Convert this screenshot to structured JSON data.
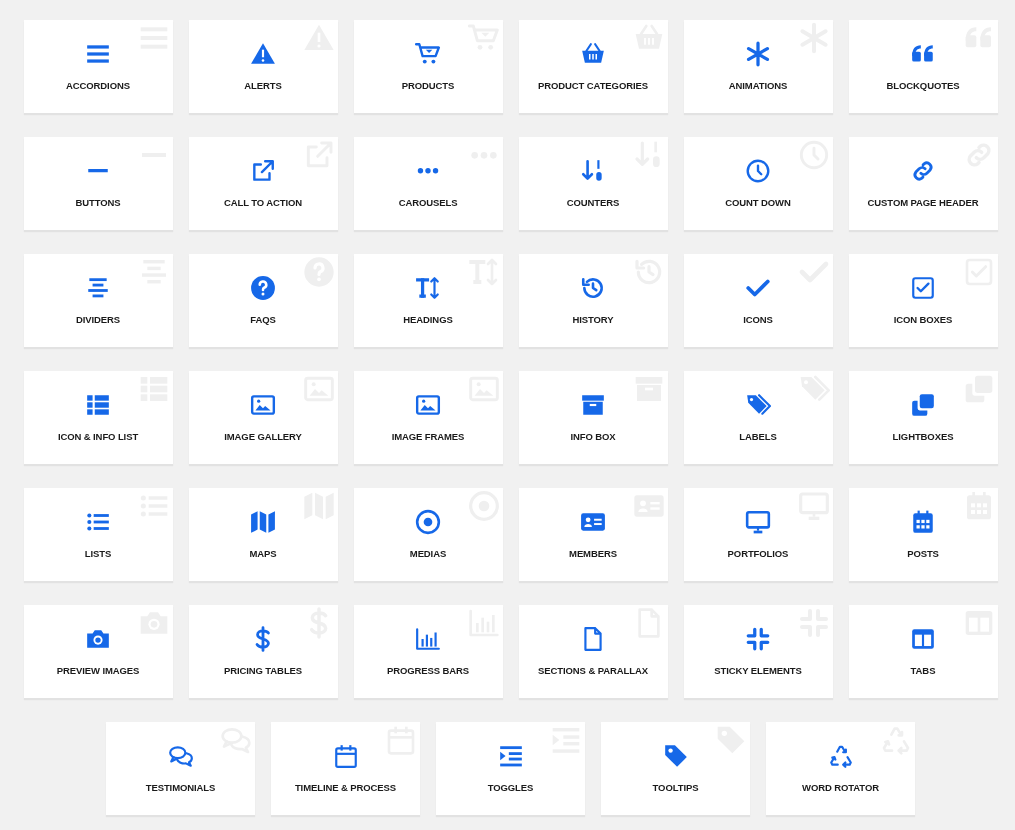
{
  "rows": [
    {
      "cards": [
        {
          "label": "ACCORDIONS"
        },
        {
          "label": "ALERTS"
        },
        {
          "label": "PRODUCTS"
        },
        {
          "label": "PRODUCT CATEGORIES"
        },
        {
          "label": "ANIMATIONS"
        },
        {
          "label": "BLOCKQUOTES"
        }
      ]
    },
    {
      "cards": [
        {
          "label": "BUTTONS"
        },
        {
          "label": "CALL TO ACTION"
        },
        {
          "label": "CAROUSELS"
        },
        {
          "label": "COUNTERS"
        },
        {
          "label": "COUNT DOWN"
        },
        {
          "label": "CUSTOM PAGE HEADER"
        }
      ]
    },
    {
      "cards": [
        {
          "label": "DIVIDERS"
        },
        {
          "label": "FAQS"
        },
        {
          "label": "HEADINGS"
        },
        {
          "label": "HISTORY"
        },
        {
          "label": "ICONS"
        },
        {
          "label": "ICON BOXES"
        }
      ]
    },
    {
      "cards": [
        {
          "label": "ICON & INFO LIST"
        },
        {
          "label": "IMAGE GALLERY"
        },
        {
          "label": "IMAGE FRAMES"
        },
        {
          "label": "INFO BOX"
        },
        {
          "label": "LABELS"
        },
        {
          "label": "LIGHTBOXES"
        }
      ]
    },
    {
      "cards": [
        {
          "label": "LISTS"
        },
        {
          "label": "MAPS"
        },
        {
          "label": "MEDIAS"
        },
        {
          "label": "MEMBERS"
        },
        {
          "label": "PORTFOLIOS"
        },
        {
          "label": "POSTS"
        }
      ]
    },
    {
      "cards": [
        {
          "label": "PREVIEW IMAGES"
        },
        {
          "label": "PRICING TABLES"
        },
        {
          "label": "PROGRESS BARS"
        },
        {
          "label": "SECTIONS & PARALLAX"
        },
        {
          "label": "STICKY ELEMENTS"
        },
        {
          "label": "TABS"
        }
      ]
    },
    {
      "cards": [
        {
          "label": "TESTIMONIALS"
        },
        {
          "label": "TIMELINE & PROCESS"
        },
        {
          "label": "TOGGLES"
        },
        {
          "label": "TOOLTIPS"
        },
        {
          "label": "WORD ROTATOR"
        }
      ]
    }
  ]
}
